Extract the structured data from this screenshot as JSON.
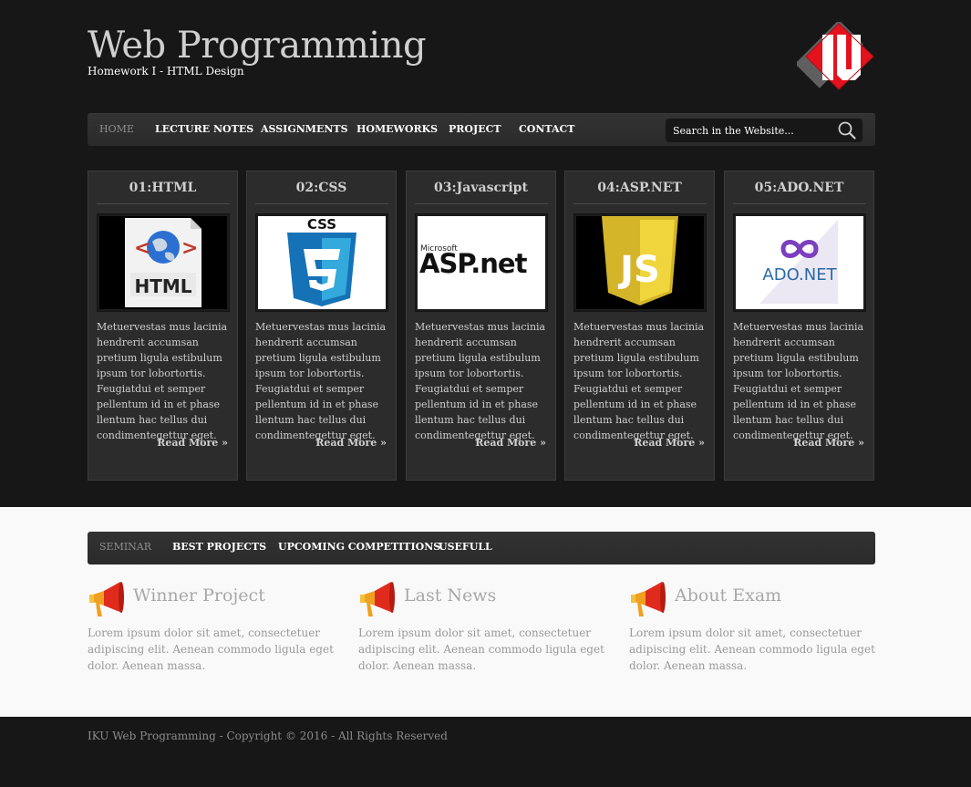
{
  "header": {
    "title": "Web Programming",
    "subtitle": "Homework I - HTML Design",
    "logo_text": "IKU"
  },
  "nav": {
    "items": [
      {
        "label": "HOME",
        "active": true
      },
      {
        "label": "LECTURE NOTES"
      },
      {
        "label": "ASSIGNMENTS"
      },
      {
        "label": "HOMEWORKS"
      },
      {
        "label": "PROJECT"
      },
      {
        "label": "CONTACT"
      }
    ],
    "search_placeholder": "Search in the Website..."
  },
  "cards": [
    {
      "title": "01:HTML",
      "image_label": "HTML",
      "icon": "html-icon",
      "text": "Metuervestas mus lacinia hendrerit accumsan pretium ligula estibulum ipsum tor lobortortis. Feugiatdui et semper pellentum id in et phase llentum hac tellus dui condimentegettur eget.",
      "more": "Read More »"
    },
    {
      "title": "02:CSS",
      "image_label": "CSS",
      "icon": "css3-icon",
      "text": "Metuervestas mus lacinia hendrerit accumsan pretium ligula estibulum ipsum tor lobortortis. Feugiatdui et semper pellentum id in et phase llentum hac tellus dui condimentegettur eget.",
      "more": "Read More »"
    },
    {
      "title": "03:Javascript",
      "image_label": "ASP.net",
      "image_small": "Microsoft",
      "icon": "aspnet-logo",
      "text": "Metuervestas mus lacinia hendrerit accumsan pretium ligula estibulum ipsum tor lobortortis. Feugiatdui et semper pellentum id in et phase llentum hac tellus dui condimentegettur eget.",
      "more": "Read More »"
    },
    {
      "title": "04:ASP.NET",
      "image_label": "JS",
      "icon": "js-icon",
      "text": "Metuervestas mus lacinia hendrerit accumsan pretium ligula estibulum ipsum tor lobortortis. Feugiatdui et semper pellentum id in et phase llentum hac tellus dui condimentegettur eget.",
      "more": "Read More »"
    },
    {
      "title": "05:ADO.NET",
      "image_label": "ADO.NET",
      "icon": "adonet-logo",
      "text": "Metuervestas mus lacinia hendrerit accumsan pretium ligula estibulum ipsum tor lobortortis. Feugiatdui et semper pellentum id in et phase llentum hac tellus dui condimentegettur eget.",
      "more": "Read More »"
    }
  ],
  "nav2": {
    "items": [
      {
        "label": "SEMINAR",
        "active": true
      },
      {
        "label": "BEST PROJECTS"
      },
      {
        "label": "UPCOMING COMPETITIONS"
      },
      {
        "label": "USEFULL"
      }
    ]
  },
  "features": [
    {
      "title": "Winner Project",
      "icon": "megaphone-icon",
      "text": "Lorem ipsum dolor sit amet, consectetuer adipiscing elit. Aenean commodo ligula eget dolor. Aenean massa."
    },
    {
      "title": "Last News",
      "icon": "megaphone-icon",
      "text": "Lorem ipsum dolor sit amet, consectetuer adipiscing elit. Aenean commodo ligula eget dolor. Aenean massa."
    },
    {
      "title": "About Exam",
      "icon": "megaphone-icon",
      "text": "Lorem ipsum dolor sit amet, consectetuer adipiscing elit. Aenean commodo ligula eget dolor. Aenean massa."
    }
  ],
  "footer": {
    "copyright": "IKU Web Programming - Copyright © 2016 - All Rights Reserved"
  },
  "colors": {
    "background_dark": "#171717",
    "panel": "#2c2c2c",
    "logo_red": "#e3121c",
    "light_section": "#f9f9f9"
  }
}
